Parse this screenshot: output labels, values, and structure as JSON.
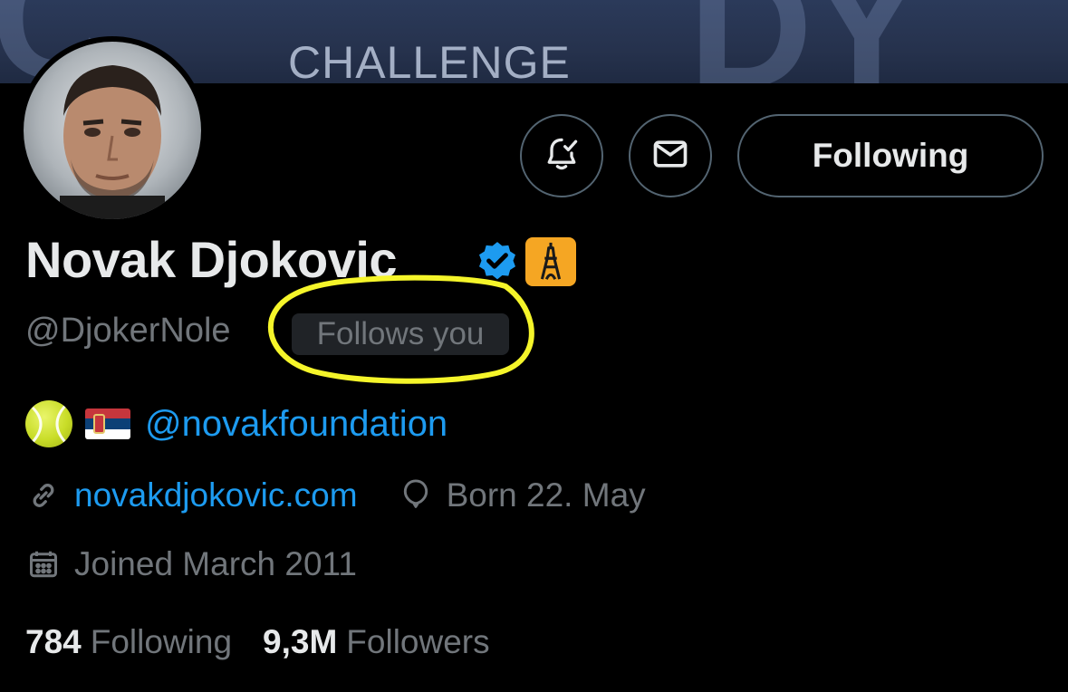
{
  "banner": {
    "text": "CHALLENGE"
  },
  "actions": {
    "notify_icon": "bell-check-icon",
    "mail_icon": "envelope-icon",
    "following_label": "Following"
  },
  "profile": {
    "name": "Novak Djokovic",
    "verified_icon": "verified-badge-icon",
    "emoji_icon": "eiffel-tower-icon",
    "handle": "@DjokerNole",
    "follows_you": "Follows you",
    "bio_link": "@novakfoundation",
    "website": "novakdjokovic.com",
    "birthday": "Born 22. May",
    "joined": "Joined March 2011"
  },
  "stats": {
    "following_count": "784",
    "following_label": "Following",
    "followers_count": "9,3M",
    "followers_label": "Followers"
  },
  "colors": {
    "background": "#000000",
    "text": "#e7e9ea",
    "muted": "#71767b",
    "link": "#1d9bf0",
    "highlight": "#f5f52a"
  }
}
